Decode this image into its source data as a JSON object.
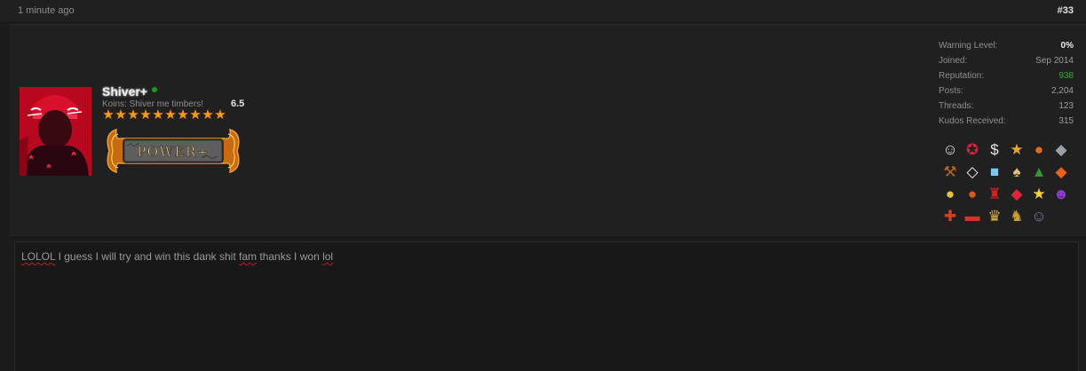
{
  "post": {
    "time": "1 minute ago",
    "number": "#33"
  },
  "user": {
    "name": "Shiver+",
    "koins_label": "Koins: Shiver me timbers!",
    "koins_value": "6.5",
    "star_count": 10,
    "rank_badge": "POWER+"
  },
  "stats": [
    {
      "label": "Warning Level:",
      "value": "0%"
    },
    {
      "label": "Joined:",
      "value": "Sep 2014"
    },
    {
      "label": "Reputation:",
      "value": "938"
    },
    {
      "label": "Posts:",
      "value": "2,204"
    },
    {
      "label": "Threads:",
      "value": "123"
    },
    {
      "label": "Kudos Received:",
      "value": "315"
    }
  ],
  "awards": [
    [
      "stormtrooper-icon",
      "captain-shield-icon",
      "money-bag-icon",
      "star-award-icon",
      "pumpkin-icon",
      "hat-icon"
    ],
    [
      "gavel-icon",
      "diamond-icon",
      "ice-cube-icon",
      "suit-icon",
      "christmas-tree-icon",
      "gem-icon"
    ],
    [
      "gold-medal-icon",
      "balls-icon",
      "red-robot-icon",
      "ruby-icon",
      "gold-star-icon",
      "devil-face-icon"
    ],
    [
      "crosshair-badge-icon",
      "pill-icon",
      "trophy-icon",
      "car-emblem-icon",
      "portrait-icon"
    ]
  ],
  "award_glyphs": {
    "stormtrooper-icon": "☺",
    "captain-shield-icon": "✪",
    "money-bag-icon": "$",
    "star-award-icon": "★",
    "pumpkin-icon": "●",
    "hat-icon": "◆",
    "gavel-icon": "⚒",
    "diamond-icon": "◇",
    "ice-cube-icon": "■",
    "suit-icon": "♠",
    "christmas-tree-icon": "▲",
    "gem-icon": "◆",
    "gold-medal-icon": "●",
    "balls-icon": "●",
    "red-robot-icon": "♜",
    "ruby-icon": "◆",
    "gold-star-icon": "★",
    "devil-face-icon": "☻",
    "crosshair-badge-icon": "✚",
    "pill-icon": "▬",
    "trophy-icon": "♛",
    "car-emblem-icon": "♞",
    "portrait-icon": "☺"
  },
  "award_colors": {
    "stormtrooper-icon": "#e8e8e8",
    "captain-shield-icon": "#c8283a",
    "money-bag-icon": "#e8e8e8",
    "star-award-icon": "#e7a632",
    "pumpkin-icon": "#e86a10",
    "hat-icon": "#9aa0a8",
    "gavel-icon": "#b5652a",
    "diamond-icon": "#e8f2ff",
    "ice-cube-icon": "#7cc6f0",
    "suit-icon": "#e0c080",
    "christmas-tree-icon": "#2e9a2e",
    "gem-icon": "#f0601a",
    "gold-medal-icon": "#e6c040",
    "balls-icon": "#d55a20",
    "red-robot-icon": "#d02020",
    "ruby-icon": "#e0243a",
    "gold-star-icon": "#f4d23a",
    "devil-face-icon": "#8c3cd8",
    "crosshair-badge-icon": "#d84020",
    "pill-icon": "#d83030",
    "trophy-icon": "#d8b040",
    "car-emblem-icon": "#c8a030",
    "portrait-icon": "#8a7aa8"
  },
  "message": {
    "parts": [
      {
        "text": "LOLOL",
        "misspelled": true
      },
      {
        "text": " I guess I will try and win this dank shit ",
        "misspelled": false
      },
      {
        "text": "fam",
        "misspelled": true
      },
      {
        "text": " thanks I won ",
        "misspelled": false
      },
      {
        "text": "lol",
        "misspelled": true
      }
    ]
  }
}
